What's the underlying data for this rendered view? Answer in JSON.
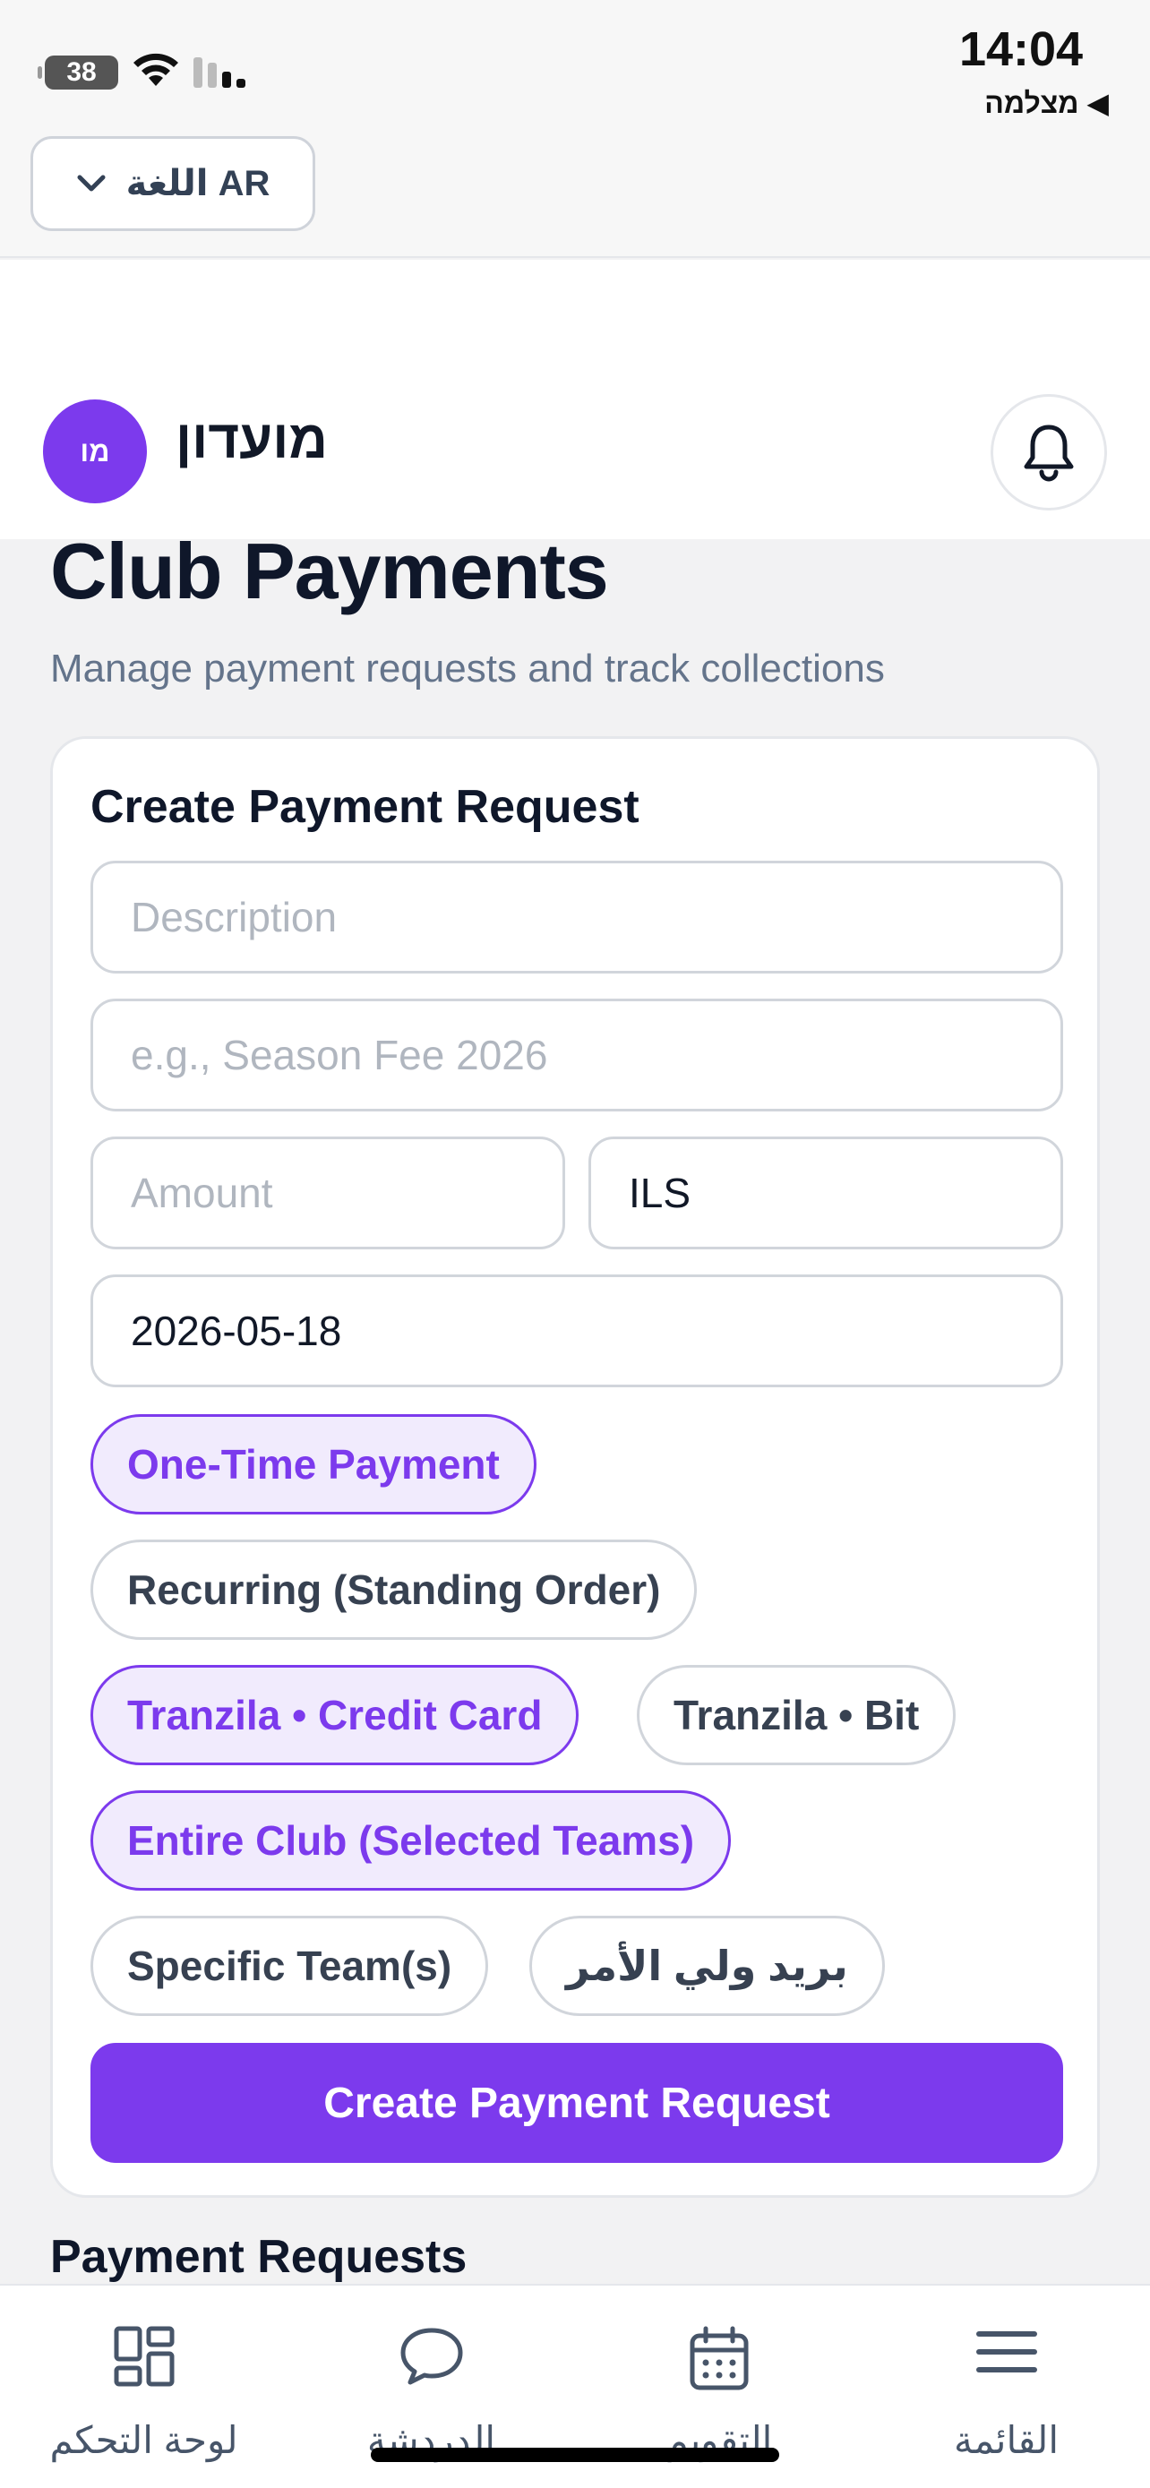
{
  "status_bar": {
    "time": "14:04",
    "battery": "38",
    "back_app": "◀ מצלמה"
  },
  "language": {
    "label": "اللغة AR"
  },
  "header": {
    "avatar_initials": "מו",
    "club_name": "מועדון"
  },
  "page": {
    "title": "Club Payments",
    "subtitle": "Manage payment requests and track collections"
  },
  "form": {
    "title": "Create Payment Request",
    "description_placeholder": "Description",
    "name_placeholder": "e.g., Season Fee 2026",
    "amount_placeholder": "Amount",
    "currency_value": "ILS",
    "date_value": "2026-05-18",
    "payment_types": [
      {
        "label": "One-Time Payment",
        "active": true
      },
      {
        "label": "Recurring (Standing Order)",
        "active": false
      }
    ],
    "providers": [
      {
        "label": "Tranzila • Credit Card",
        "active": true
      },
      {
        "label": "Tranzila • Bit",
        "active": false
      }
    ],
    "targets": [
      {
        "label": "Entire Club (Selected Teams)",
        "active": true
      },
      {
        "label": "Specific Team(s)",
        "active": false
      },
      {
        "label": "بريد ولي الأمر",
        "active": false
      }
    ],
    "submit_label": "Create Payment Request"
  },
  "requests_section": {
    "title": "Payment Requests"
  },
  "tabbar": {
    "items": [
      {
        "label": "لوحة التحكم",
        "icon": "dashboard-icon"
      },
      {
        "label": "الدردشة",
        "icon": "chat-icon"
      },
      {
        "label": "التقويم",
        "icon": "calendar-icon"
      },
      {
        "label": "القائمة",
        "icon": "menu-icon"
      }
    ]
  },
  "colors": {
    "accent": "#7c3aed",
    "accent_light": "#f1ebfd",
    "text_primary": "#0f172a",
    "text_secondary": "#64748b"
  }
}
